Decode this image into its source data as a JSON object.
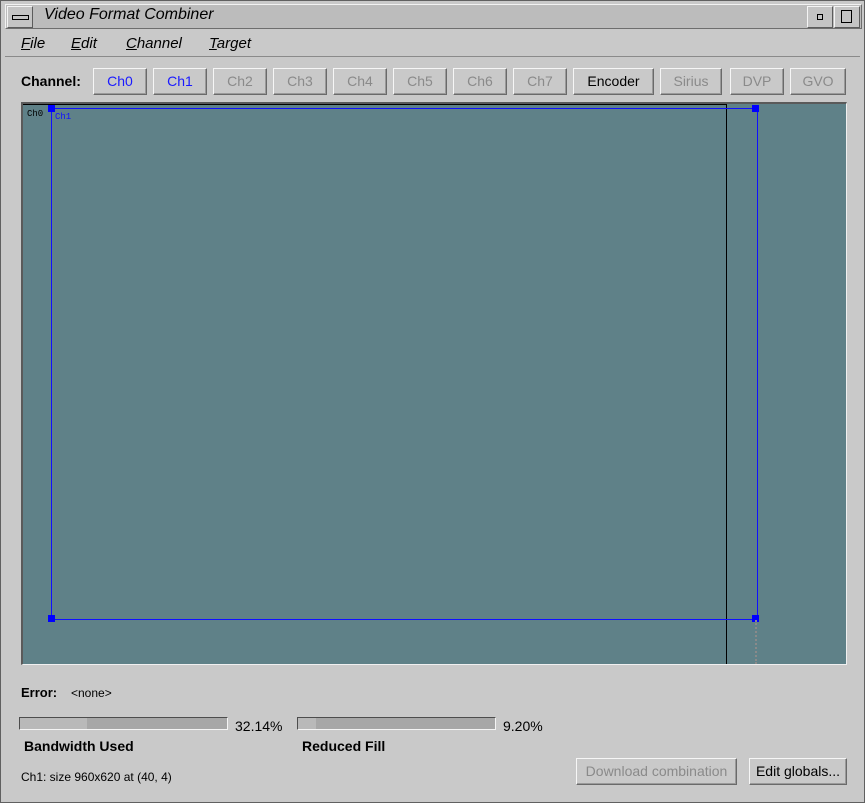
{
  "window": {
    "title": "Video Format Combiner"
  },
  "menubar": {
    "items": [
      "File",
      "Edit",
      "Channel",
      "Target"
    ]
  },
  "channel_bar": {
    "label": "Channel:",
    "buttons": [
      {
        "label": "Ch0",
        "state": "active"
      },
      {
        "label": "Ch1",
        "state": "active"
      },
      {
        "label": "Ch2",
        "state": "disabled"
      },
      {
        "label": "Ch3",
        "state": "disabled"
      },
      {
        "label": "Ch4",
        "state": "disabled"
      },
      {
        "label": "Ch5",
        "state": "disabled"
      },
      {
        "label": "Ch6",
        "state": "disabled"
      },
      {
        "label": "Ch7",
        "state": "disabled"
      },
      {
        "label": "Encoder",
        "state": "enabled"
      },
      {
        "label": "Sirius",
        "state": "disabled"
      },
      {
        "label": "DVP",
        "state": "disabled"
      },
      {
        "label": "GVO",
        "state": "disabled"
      }
    ]
  },
  "canvas": {
    "channels": [
      {
        "label": "Ch0",
        "color": "#000000"
      },
      {
        "label": "Ch1",
        "color": "#1010ff"
      }
    ]
  },
  "error": {
    "label": "Error:",
    "value": "<none>"
  },
  "meters": [
    {
      "label": "Bandwidth Used",
      "percent_text": "32.14%",
      "value": 0.3214
    },
    {
      "label": "Reduced Fill",
      "percent_text": "9.20%",
      "value": 0.092
    }
  ],
  "status": {
    "text": "Ch1: size 960x620 at (40, 4)"
  },
  "actions": {
    "download_label": "Download combination",
    "edit_globals_label": "Edit globals..."
  },
  "colors": {
    "canvas_bg": "#5f8188",
    "active_channel": "#1a1aff",
    "window_bg": "#c9c9c9"
  }
}
